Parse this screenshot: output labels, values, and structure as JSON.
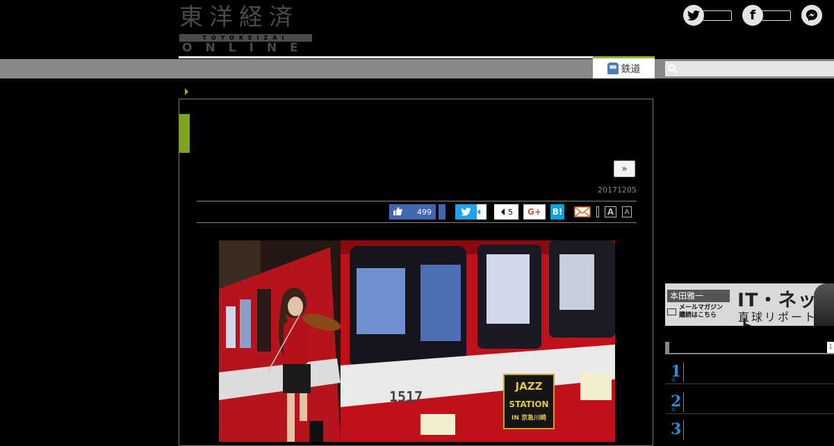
{
  "logo": {
    "jp": "東洋経済",
    "romaji": "TOYOKEIZAI",
    "online": "ONLINE"
  },
  "social": {
    "twitter_count": "",
    "facebook_count": ""
  },
  "nav": {
    "tab_label": "鉄道",
    "search_placeholder": ""
  },
  "article": {
    "next_label": "»",
    "date": "20171205"
  },
  "share": {
    "fb_like_count": "499",
    "hatena_count": "5",
    "gplus_label": "G+",
    "hatena_label": "B!",
    "font_large": "A",
    "font_small": "A"
  },
  "sidebar": {
    "ad": {
      "name": "本田雅一",
      "mail_line1": "メールマガジン",
      "mail_line2": "購読はこちら",
      "title": "IT・ネット",
      "subtitle": "直球リポート"
    },
    "ranking_tab": "1",
    "ranking": [
      {
        "rank": "1",
        "suffix": "位"
      },
      {
        "rank": "2",
        "suffix": "位"
      },
      {
        "rank": "3",
        "suffix": "位"
      }
    ]
  },
  "photo": {
    "train_number": "1517",
    "sign_line1": "JAZZ",
    "sign_line2": "STATION",
    "sign_line3": "IN 京急川崎"
  },
  "colors": {
    "accent_green": "#8db82a",
    "facebook": "#4267b2",
    "twitter": "#1da1f2",
    "hatena": "#00a4de",
    "rank_blue": "#2b8fd8"
  }
}
